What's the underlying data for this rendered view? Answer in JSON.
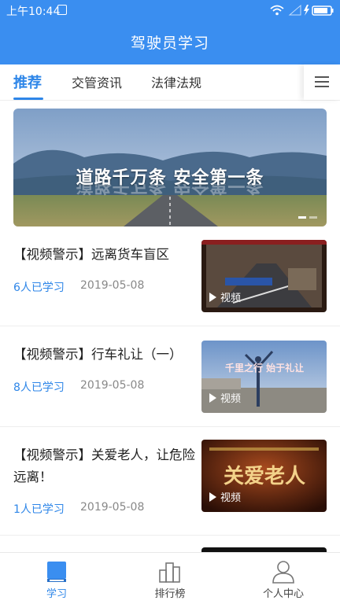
{
  "status_bar": {
    "time": "上午10:44",
    "icons": [
      "sim-icon",
      "wifi-icon",
      "signal-icon",
      "charging-icon",
      "battery-icon"
    ]
  },
  "header": {
    "title": "驾驶员学习"
  },
  "tabs": [
    {
      "label": "推荐",
      "active": true
    },
    {
      "label": "交管资讯",
      "active": false
    },
    {
      "label": "法律法规",
      "active": false
    }
  ],
  "banner": {
    "text": "道路千万条  安全第一条",
    "pages": 2,
    "current_page": 1
  },
  "articles": [
    {
      "title": "【视频警示】远离货车盲区",
      "count": "6人已学习",
      "date": "2019-05-08",
      "thumb_label": "视频",
      "thumb_caption": ""
    },
    {
      "title": "【视频警示】行车礼让（一）",
      "count": "8人已学习",
      "date": "2019-05-08",
      "thumb_label": "视频",
      "thumb_caption": "千里之行 始于礼让"
    },
    {
      "title": "【视频警示】关爱老人，让危险远离！",
      "count": "1人已学习",
      "date": "2019-05-08",
      "thumb_label": "视频",
      "thumb_caption": "关爱老人"
    }
  ],
  "bottom_nav": [
    {
      "label": "学习",
      "icon": "book-icon",
      "active": true
    },
    {
      "label": "排行榜",
      "icon": "ranking-icon",
      "active": false
    },
    {
      "label": "个人中心",
      "icon": "person-icon",
      "active": false
    }
  ],
  "colors": {
    "primary": "#3a8ef0",
    "accent": "#2e86e8"
  }
}
